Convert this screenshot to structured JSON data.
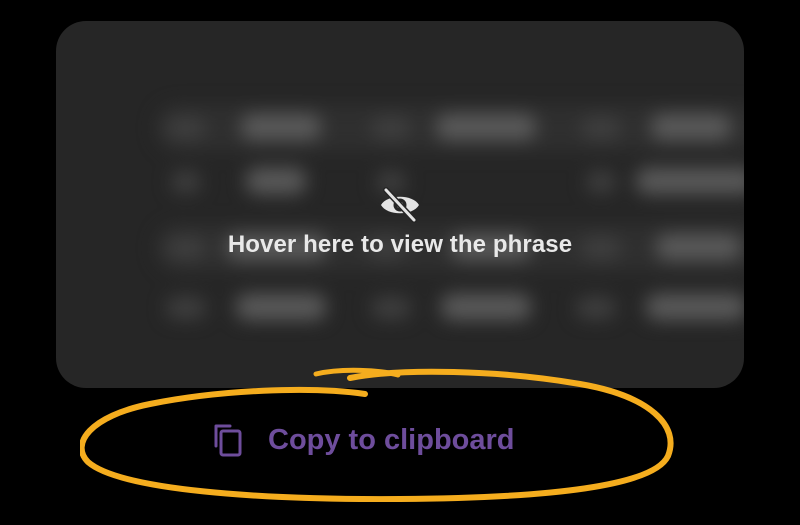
{
  "phrase_card": {
    "hover_text": "Hover here to view the phrase",
    "hidden_icon": "eye-slash-icon",
    "background_color": "#262626"
  },
  "copy": {
    "label": "Copy to clipboard",
    "icon": "copy-icon",
    "accent_color": "#6e4d9c",
    "highlight_color": "#f5ad1e"
  }
}
